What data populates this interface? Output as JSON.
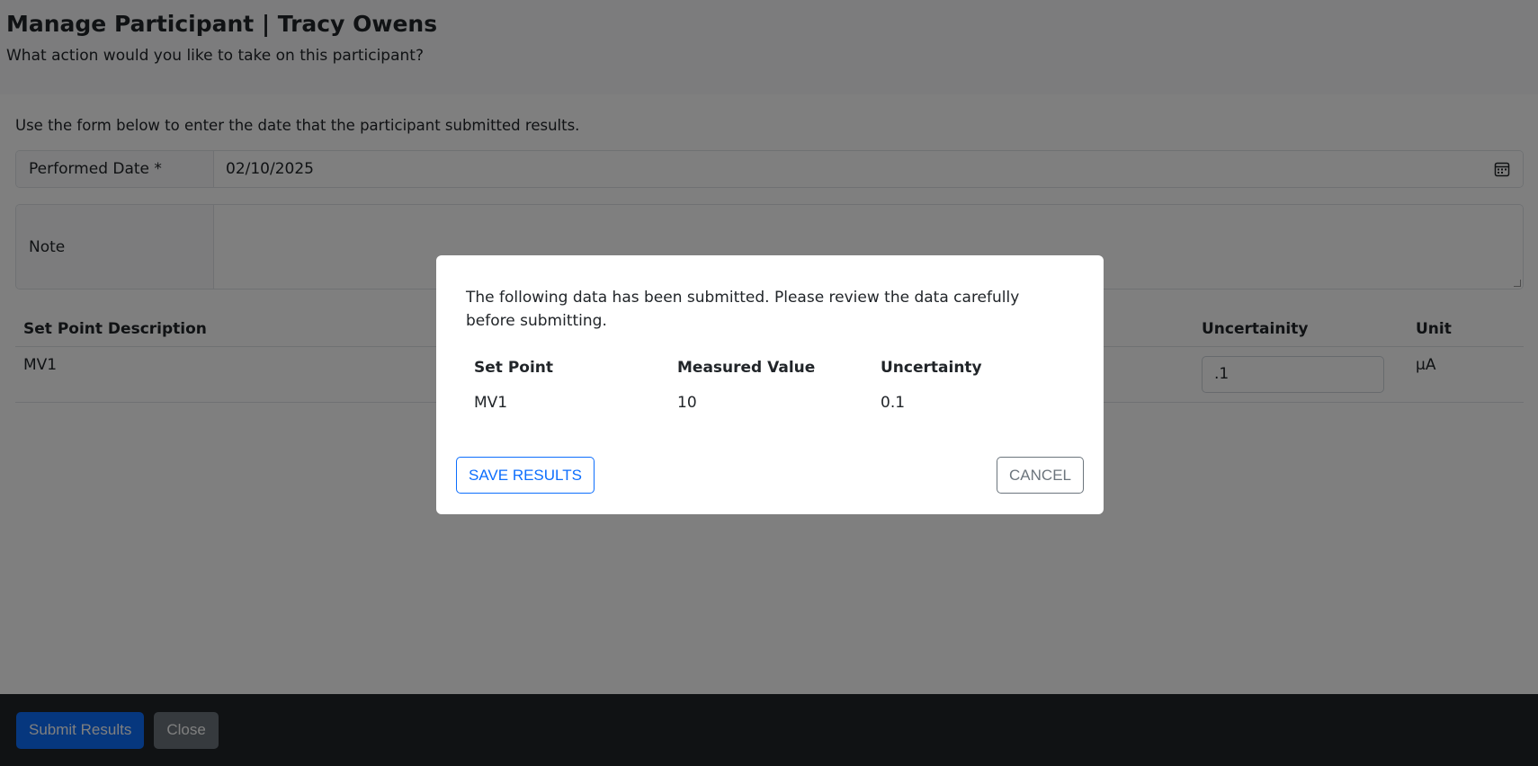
{
  "header": {
    "title": "Manage Participant | Tracy Owens",
    "subtitle": "What action would you like to take on this participant?"
  },
  "form": {
    "intro": "Use the form below to enter the date that the participant submitted results.",
    "performed_date_label": "Performed Date *",
    "performed_date_value": "02/10/2025",
    "note_label": "Note",
    "note_value": ""
  },
  "set_point_table": {
    "headers": {
      "description": "Set Point Description",
      "uncertainty": "Uncertainity",
      "unit": "Unit"
    },
    "rows": [
      {
        "description": "MV1",
        "uncertainty": ".1",
        "unit": "μA"
      }
    ]
  },
  "footer": {
    "submit_label": "Submit Results",
    "close_label": "Close"
  },
  "modal": {
    "message": "The following data has been submitted. Please review the data carefully before submitting.",
    "headers": {
      "set_point": "Set Point",
      "measured_value": "Measured Value",
      "uncertainty": "Uncertainty"
    },
    "rows": [
      {
        "set_point": "MV1",
        "measured_value": "10",
        "uncertainty": "0.1"
      }
    ],
    "save_label": "SAVE RESULTS",
    "cancel_label": "CANCEL"
  },
  "colors": {
    "primary": "#0d6efd",
    "secondary": "#6c757d",
    "footer_bg": "#212529"
  }
}
